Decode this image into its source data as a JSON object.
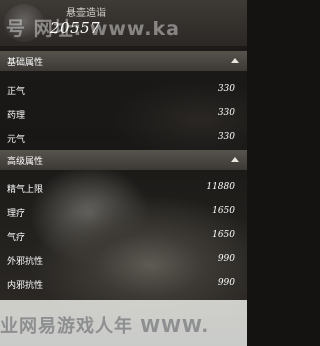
{
  "header": {
    "title": "悬壶造诣",
    "score": "20557",
    "watermark": "号 网址: www.ka"
  },
  "sections": [
    {
      "label": "基础属性",
      "rows": [
        {
          "name": "正气",
          "value": "330"
        },
        {
          "name": "药理",
          "value": "330"
        },
        {
          "name": "元气",
          "value": "330"
        }
      ]
    },
    {
      "label": "高级属性",
      "rows": [
        {
          "name": "精气上限",
          "value": "11880"
        },
        {
          "name": "理疗",
          "value": "1650"
        },
        {
          "name": "气疗",
          "value": "1650"
        },
        {
          "name": "外邪抗性",
          "value": "990"
        },
        {
          "name": "内邪抗性",
          "value": "990"
        }
      ]
    }
  ],
  "footer": {
    "watermark": "业网易游戏人年 WWW."
  }
}
